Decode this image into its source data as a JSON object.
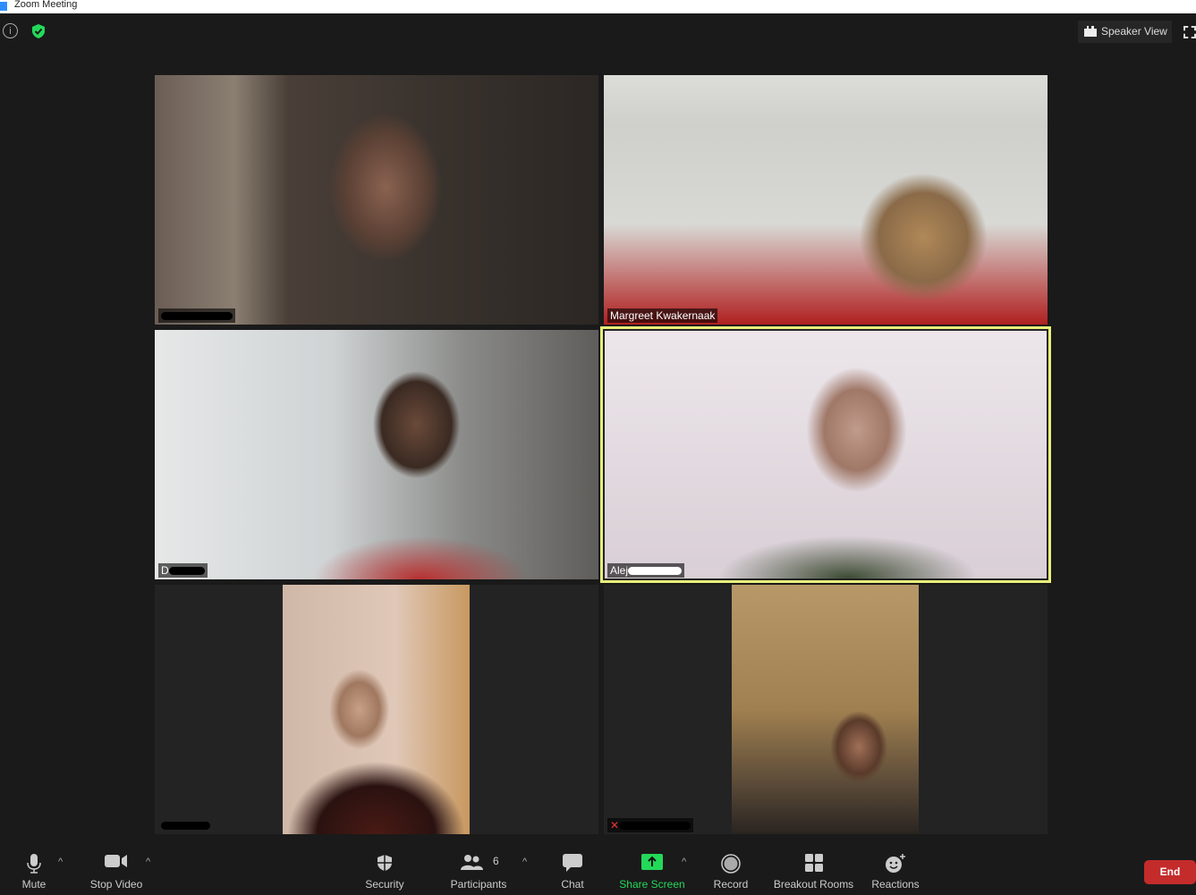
{
  "window": {
    "title": "Zoom Meeting"
  },
  "header": {
    "view_button": "Speaker View"
  },
  "participants": [
    {
      "name": "",
      "active": false
    },
    {
      "name": "Margreet Kwakernaak",
      "active": false
    },
    {
      "name": "D",
      "active": false
    },
    {
      "name": "Alej",
      "active": true
    },
    {
      "name": "",
      "active": false
    },
    {
      "name": "",
      "active": false
    }
  ],
  "toolbar": {
    "mute": "Mute",
    "stop_video": "Stop Video",
    "security": "Security",
    "participants": "Participants",
    "participants_count": "6",
    "chat": "Chat",
    "share_screen": "Share Screen",
    "record": "Record",
    "breakout_rooms": "Breakout Rooms",
    "reactions": "Reactions",
    "end": "End"
  },
  "colors": {
    "active_speaker": "#e8ee7a",
    "share_green": "#23d959",
    "end_red": "#c42b2b",
    "shield_green": "#23d959"
  }
}
